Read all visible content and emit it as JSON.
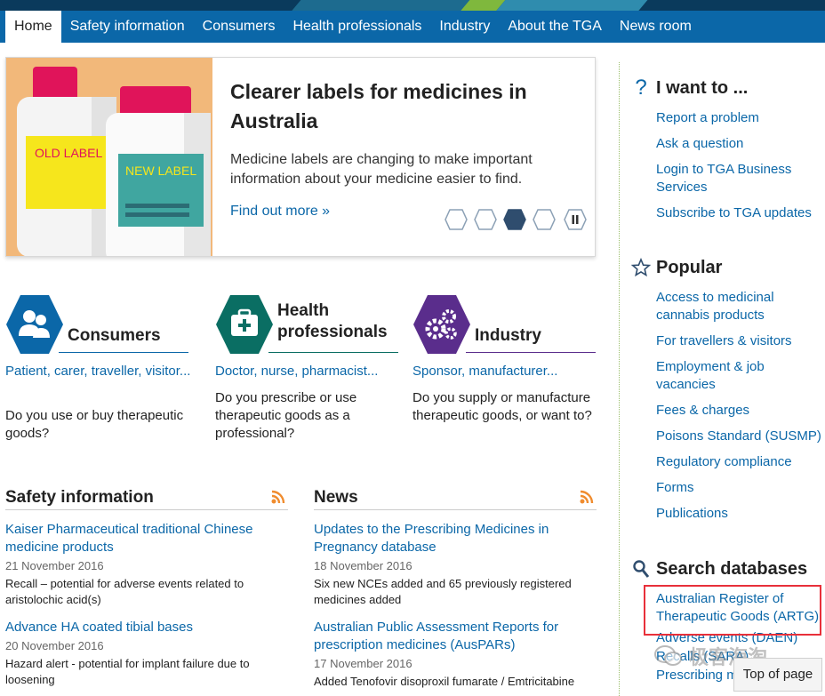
{
  "nav": {
    "items": [
      {
        "label": "Home",
        "active": true
      },
      {
        "label": "Safety information"
      },
      {
        "label": "Consumers"
      },
      {
        "label": "Health professionals"
      },
      {
        "label": "Industry"
      },
      {
        "label": "About the TGA"
      },
      {
        "label": "News room"
      }
    ]
  },
  "hero": {
    "title": "Clearer labels for medicines in Australia",
    "text": "Medicine labels are changing to make important information about your medicine easier to find.",
    "link": "Find out more »",
    "image_old_label": "OLD LABEL",
    "image_new_label": "NEW LABEL",
    "active_slide": 3,
    "slide_count": 4
  },
  "audiences": [
    {
      "title": "Consumers",
      "subtitle": "Patient, carer, traveller, visitor...",
      "question": "Do you use or buy therapeutic goods?",
      "color": "#0b67a8",
      "icon": "people-icon"
    },
    {
      "title": "Health professionals",
      "subtitle": "Doctor, nurse, pharmacist...",
      "question": "Do you prescribe or use therapeutic goods as a professional?",
      "color": "#0a6e63",
      "icon": "medical-kit-icon"
    },
    {
      "title": "Industry",
      "subtitle": "Sponsor, manufacturer...",
      "question": "Do you supply or manufacture therapeutic goods, or want to?",
      "color": "#5a2d8c",
      "icon": "gears-icon"
    }
  ],
  "safety": {
    "title": "Safety information",
    "items": [
      {
        "title": "Kaiser Pharmaceutical traditional Chinese medicine products",
        "date": "21 November 2016",
        "desc": "Recall – potential for adverse events related to aristolochic acid(s)"
      },
      {
        "title": "Advance HA coated tibial bases",
        "date": "20 November 2016",
        "desc": "Hazard alert - potential for implant failure due to loosening"
      }
    ]
  },
  "news": {
    "title": "News",
    "items": [
      {
        "title": "Updates to the Prescribing Medicines in Pregnancy database",
        "date": "18 November 2016",
        "desc": "Six new NCEs added and 65 previously registered medicines added"
      },
      {
        "title": "Australian Public Assessment Reports for prescription medicines (AusPARs)",
        "date": "17 November 2016",
        "desc": "Added Tenofovir disoproxil fumarate / Emtricitabine"
      }
    ]
  },
  "sidebar": {
    "iwant": {
      "title": "I want to ...",
      "links": [
        "Report a problem",
        "Ask a question",
        "Login to TGA Business Services",
        "Subscribe to TGA updates"
      ]
    },
    "popular": {
      "title": "Popular",
      "links": [
        "Access to medicinal cannabis products",
        "For travellers & visitors",
        "Employment & job vacancies",
        "Fees & charges",
        "Poisons Standard (SUSMP)",
        "Regulatory compliance",
        "Forms",
        "Publications"
      ]
    },
    "search": {
      "title": "Search databases",
      "links": [
        "Australian Register of Therapeutic Goods (ARTG)",
        "Adverse events (DAEN)",
        "Recalls (SARA)",
        "Prescribing medicines in"
      ]
    }
  },
  "overlay": {
    "top_of_page": "Top of page",
    "watermark": "极客海淘"
  },
  "colors": {
    "nav": "#0b67a8",
    "link": "#0b67a8",
    "highlight": "#e8303a",
    "rss": "#f08c2e"
  }
}
